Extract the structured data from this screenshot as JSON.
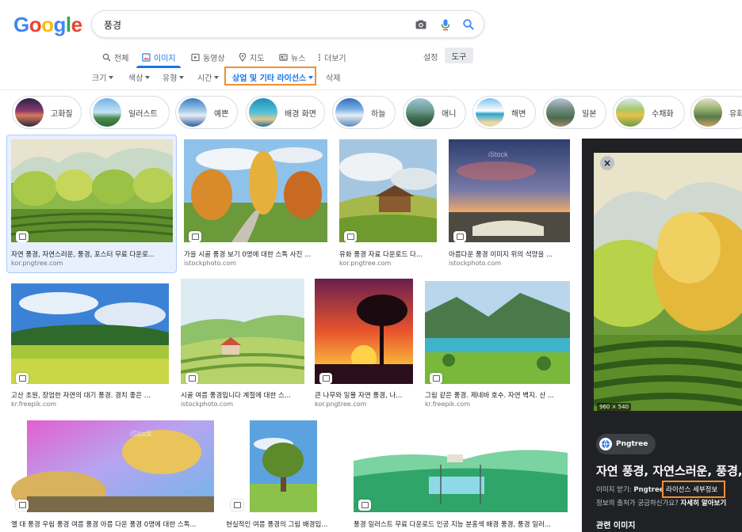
{
  "search": {
    "query": "풍경"
  },
  "logo": "Google",
  "tabs": [
    {
      "label": "전체",
      "icon": "search-icon"
    },
    {
      "label": "이미지",
      "icon": "image-icon",
      "active": true
    },
    {
      "label": "동영상",
      "icon": "video-icon"
    },
    {
      "label": "지도",
      "icon": "map-pin-icon"
    },
    {
      "label": "뉴스",
      "icon": "news-icon"
    },
    {
      "label": "더보기",
      "icon": "more-vert-icon"
    }
  ],
  "settings_label": "설정",
  "tools_label": "도구",
  "filters": [
    {
      "label": "크기"
    },
    {
      "label": "색상"
    },
    {
      "label": "유형"
    },
    {
      "label": "시간"
    },
    {
      "label": "상업 및 기타 라이선스",
      "highlighted": true
    },
    {
      "label": "삭제"
    }
  ],
  "chips": [
    {
      "label": "고화질"
    },
    {
      "label": "일러스트"
    },
    {
      "label": "예쁜"
    },
    {
      "label": "배경 화면"
    },
    {
      "label": "하늘"
    },
    {
      "label": "애니"
    },
    {
      "label": "해변"
    },
    {
      "label": "일본"
    },
    {
      "label": "수채화"
    },
    {
      "label": "유화"
    }
  ],
  "results": [
    {
      "title": "자연 풍경, 자연스러운, 풍경, 포스터 무료 다운로...",
      "source": "kor.pngtree.com",
      "selected": true
    },
    {
      "title": "가을 시골 풍경 보기 0명에 대한 스톡 사진 ...",
      "source": "istockphoto.com"
    },
    {
      "title": "유화 풍경 자료 다운로드 다...",
      "source": "kor.pngtree.com"
    },
    {
      "title": "아름다운 풍경 이미지 위의 석양을 ...",
      "source": "istockphoto.com"
    },
    {
      "title": "고산 초원, 장엄한 자연의 대기 풍경. 경치 좋은 ...",
      "source": "kr.freepik.com"
    },
    {
      "title": "시골 여름 풍경입니다 계절에 대한 스...",
      "source": "istockphoto.com"
    },
    {
      "title": "큰 나무와 일몰 자연 풍경, 나...",
      "source": "kor.pngtree.com"
    },
    {
      "title": "그림 같은 풍경. 제네바 호수. 자연 벽지. 산 ...",
      "source": "kr.freepik.com"
    },
    {
      "title": "옐 대 풍경 우림 풍경 여름 풍경 아름 다운 풍경 0명에 대한 스톡...",
      "source": ""
    },
    {
      "title": "현실적인 여름 풍경의 그림 배경입...",
      "source": ""
    },
    {
      "title": "풍경 일러스트 무료 다운로드 인공 지능 분홍색 배경 풍경, 풍경 일러...",
      "source": ""
    }
  ],
  "watermark": "iStock",
  "panel": {
    "close_icon": "close-icon",
    "dimensions": "960 × 540",
    "source_name": "Pngtree",
    "title": "자연 풍경, 자연스러운, 풍경, 포",
    "get_image_prefix": "이미지 받기:",
    "get_image_source": "Pngtree",
    "license_link": "라이선스 세부정보",
    "question_prefix": "정보의 출처가 궁금하신가요?",
    "question_link": "자세히 알아보기",
    "related": "관련 이미지"
  },
  "colors": {
    "accent": "#1a73e8",
    "highlight_box": "#f0902e",
    "panel_bg": "#202124"
  }
}
